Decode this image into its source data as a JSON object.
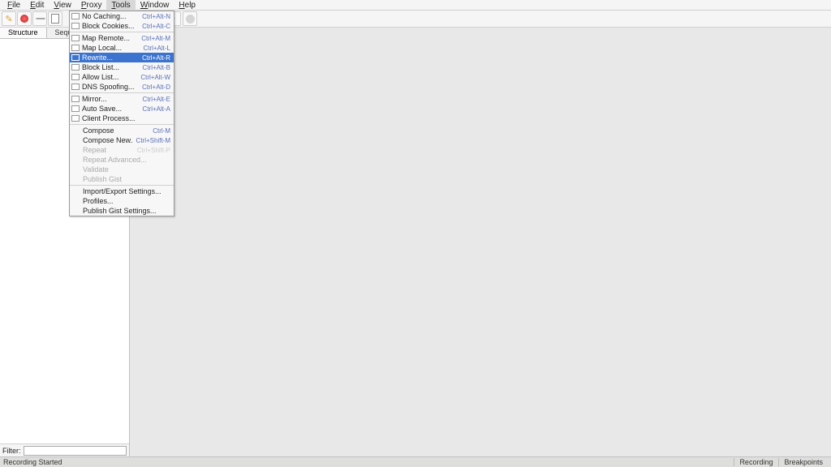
{
  "menubar": [
    "File",
    "Edit",
    "View",
    "Proxy",
    "Tools",
    "Window",
    "Help"
  ],
  "menubar_active_index": 4,
  "toolbar_icons": [
    "pencil",
    "record",
    "pause",
    "doc"
  ],
  "tabs": {
    "items": [
      "Structure",
      "Sequence"
    ],
    "active_index": 0
  },
  "filter": {
    "label": "Filter:",
    "value": ""
  },
  "statusbar": {
    "left": "Recording Started",
    "right": [
      "Recording",
      "Breakpoints"
    ]
  },
  "tools_menu": {
    "highlight_index": 4,
    "groups": [
      [
        {
          "label": "No Caching...",
          "shortcut": "Ctrl+Alt-N",
          "checkbox": true
        },
        {
          "label": "Block Cookies...",
          "shortcut": "Ctrl+Alt-C",
          "checkbox": true
        }
      ],
      [
        {
          "label": "Map Remote...",
          "shortcut": "Ctrl+Alt-M",
          "checkbox": true
        },
        {
          "label": "Map Local...",
          "shortcut": "Ctrl+Alt-L",
          "checkbox": true
        },
        {
          "label": "Rewrite...",
          "shortcut": "Ctrl+Alt-R",
          "checkbox": true
        },
        {
          "label": "Block List...",
          "shortcut": "Ctrl+Alt-B",
          "checkbox": true
        },
        {
          "label": "Allow List...",
          "shortcut": "Ctrl+Alt-W",
          "checkbox": true
        },
        {
          "label": "DNS Spoofing...",
          "shortcut": "Ctrl+Alt-D",
          "checkbox": true
        }
      ],
      [
        {
          "label": "Mirror...",
          "shortcut": "Ctrl+Alt-E",
          "checkbox": true
        },
        {
          "label": "Auto Save...",
          "shortcut": "Ctrl+Alt-A",
          "checkbox": true
        },
        {
          "label": "Client Process...",
          "shortcut": "",
          "checkbox": true
        }
      ],
      [
        {
          "label": "Compose",
          "shortcut": "Ctrl-M",
          "checkbox": false
        },
        {
          "label": "Compose New...",
          "shortcut": "Ctrl+Shift-M",
          "checkbox": false
        },
        {
          "label": "Repeat",
          "shortcut": "Ctrl+Shift-P",
          "checkbox": false,
          "disabled": true
        },
        {
          "label": "Repeat Advanced...",
          "shortcut": "",
          "checkbox": false,
          "disabled": true
        },
        {
          "label": "Validate",
          "shortcut": "",
          "checkbox": false,
          "disabled": true
        },
        {
          "label": "Publish Gist",
          "shortcut": "",
          "checkbox": false,
          "disabled": true
        }
      ],
      [
        {
          "label": "Import/Export Settings...",
          "shortcut": "",
          "checkbox": false
        },
        {
          "label": "Profiles...",
          "shortcut": "",
          "checkbox": false
        },
        {
          "label": "Publish Gist Settings...",
          "shortcut": "",
          "checkbox": false
        }
      ]
    ]
  }
}
